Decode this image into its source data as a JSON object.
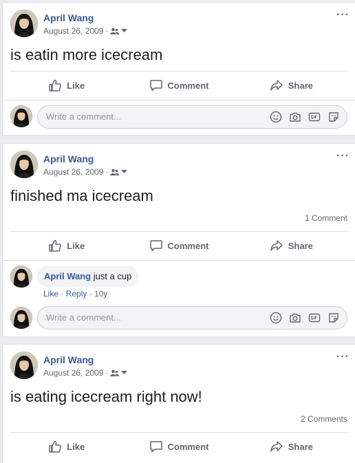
{
  "posts": [
    {
      "author": "April Wang",
      "date": "August 26, 2009",
      "separator": "·",
      "text": "is eatin more icecream",
      "more": "···"
    },
    {
      "author": "April Wang",
      "date": "August 26, 2009",
      "separator": "·",
      "text": "finished ma icecream",
      "comment_count": "1 Comment",
      "more": "···",
      "comments": [
        {
          "author": "April Wang",
          "text": "just a cup",
          "like": "Like",
          "reply": "Reply",
          "dot": "·",
          "age": "10y"
        }
      ]
    },
    {
      "author": "April Wang",
      "date": "August 26, 2009",
      "separator": "·",
      "text": "is eating icecream right now!",
      "comment_count": "2 Comments",
      "more": "···"
    }
  ],
  "actions": {
    "like": "Like",
    "comment": "Comment",
    "share": "Share"
  },
  "comment_input": {
    "placeholder": "Write a comment..."
  },
  "icons": [
    "friends-audience-icon",
    "dropdown-caret-icon",
    "like-icon",
    "comment-icon",
    "share-icon",
    "emoji-icon",
    "camera-icon",
    "gif-icon",
    "sticker-icon"
  ],
  "colors": {
    "link": "#385898",
    "muted": "#606770",
    "feed_bg": "#e9ebee"
  }
}
